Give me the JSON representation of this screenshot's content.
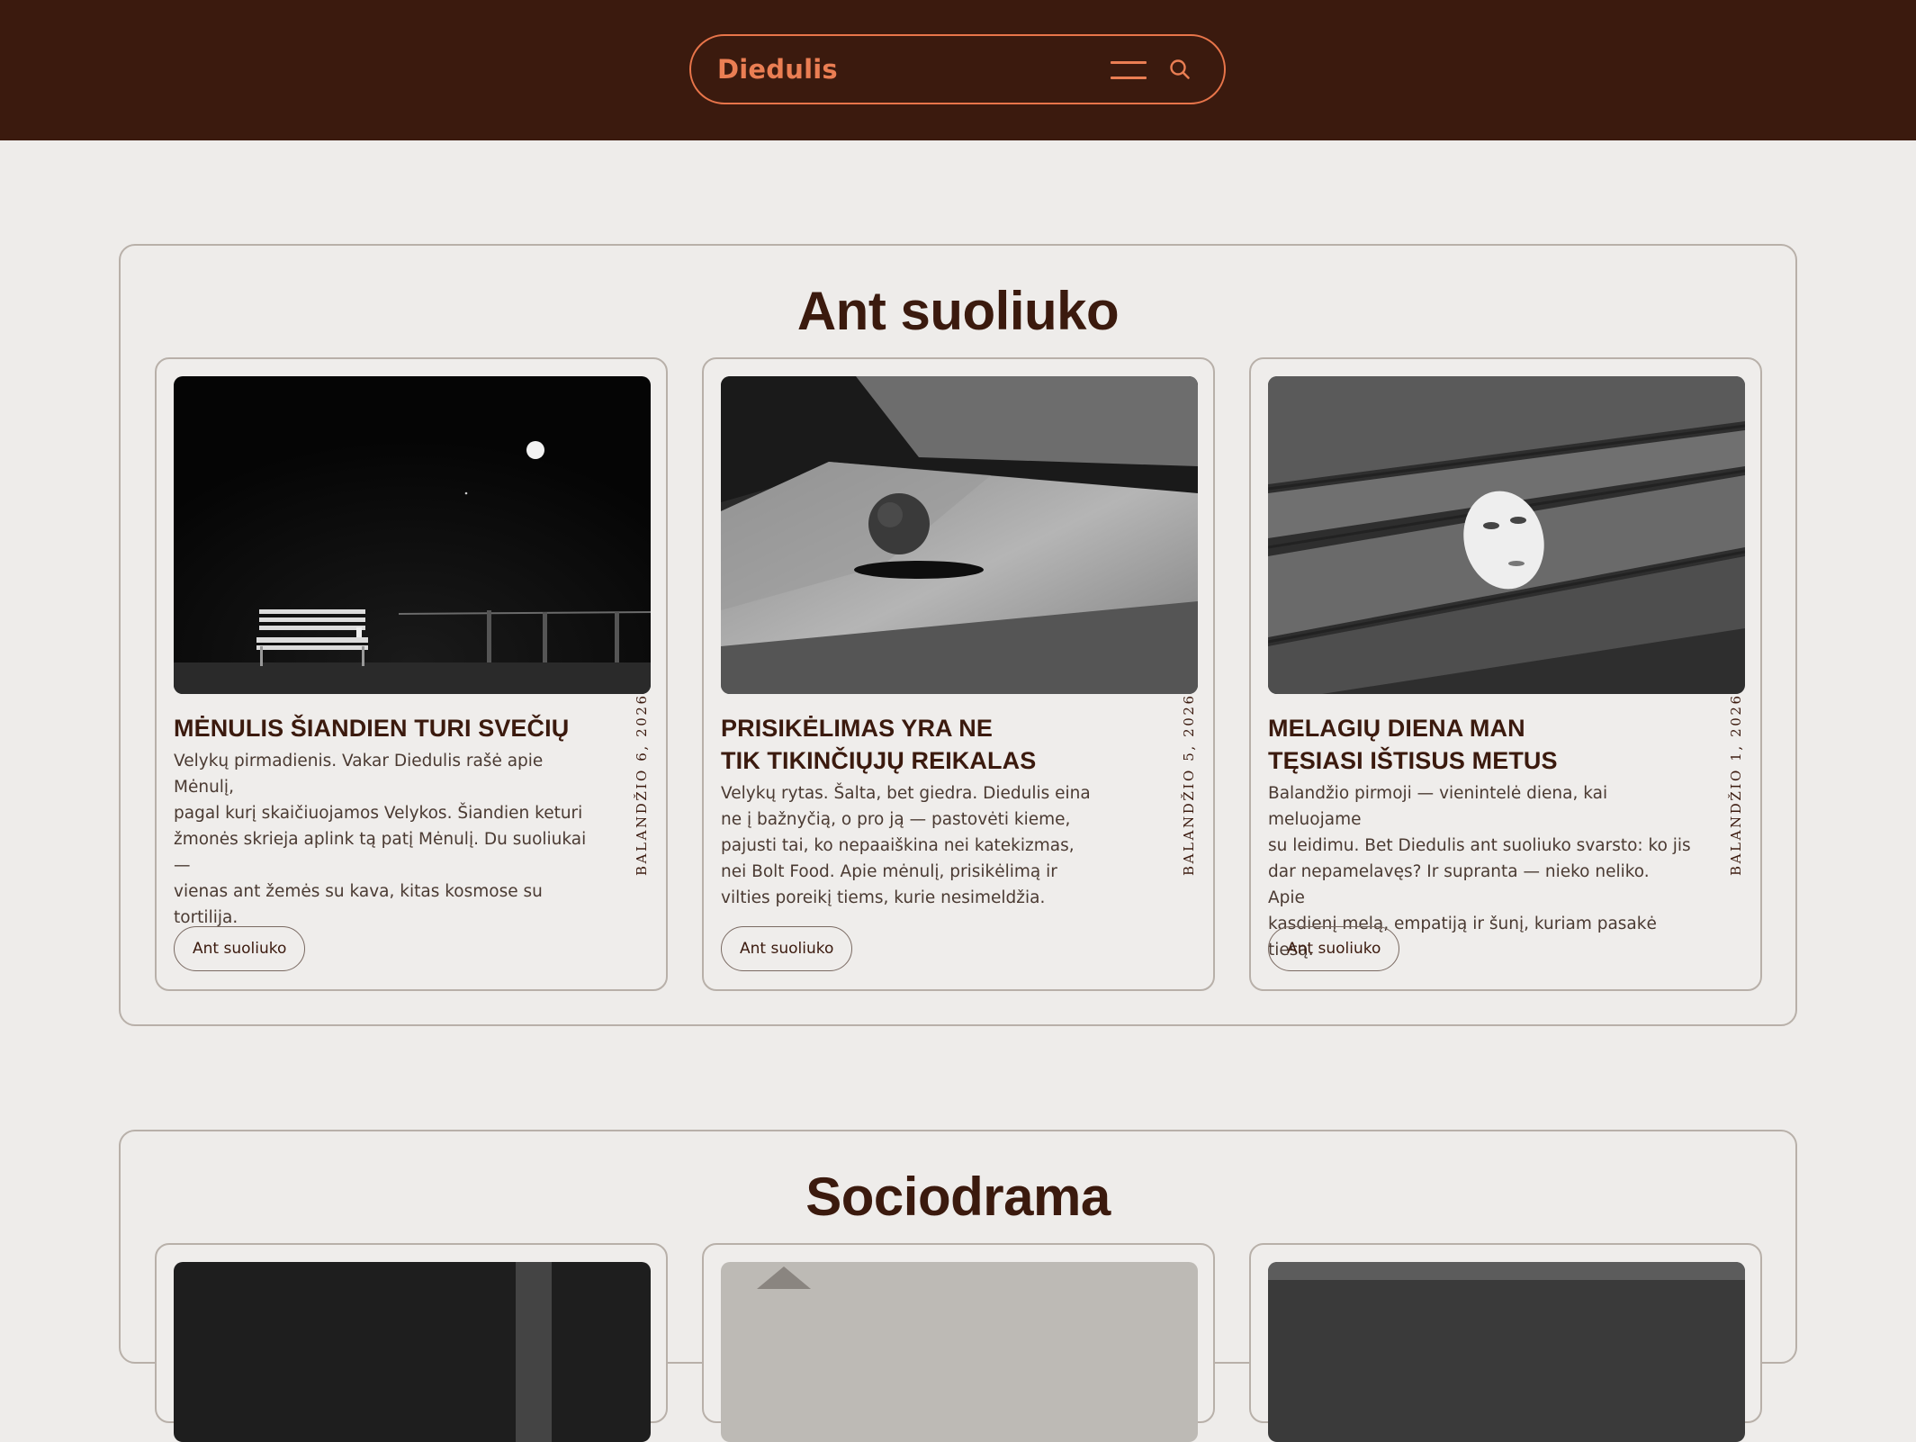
{
  "header": {
    "brand": "Diedulis",
    "menu_icon": "hamburger-menu-icon",
    "search_icon": "search-icon",
    "accent_color": "#ea7e53",
    "background_color": "#3b1a0e"
  },
  "sections": [
    {
      "title": "Ant suoliuko",
      "cards": [
        {
          "image": "Moon over a bench at night",
          "title_lines": [
            "MĖNULIS ŠIANDIEN TURI SVEČIŲ"
          ],
          "text_lines": [
            "Velykų pirmadienis. Vakar Diedulis rašė apie Mėnulį,",
            "pagal kurį skaičiuojamos Velykos. Šiandien keturi",
            "žmonės skrieja aplink tą patį Mėnulį. Du suoliukai —",
            "vienas ant žemės su kava, kitas kosmose su tortilija."
          ],
          "date": "BALANDŽIO 6, 2026",
          "tag": "Ant suoliuko"
        },
        {
          "image": "Egg on a stone slab",
          "title_lines": [
            "PRISIKĖLIMAS YRA NE",
            "TIK TIKINČIŲJŲ REIKALAS"
          ],
          "text_lines": [
            "Velykų rytas. Šalta, bet giedra. Diedulis eina",
            "ne į bažnyčią, o pro ją — pastovėti kieme,",
            "pajusti tai, ko nepaaiškina nei katekizmas,",
            "nei Bolt Food. Apie mėnulį, prisikėlimą ir",
            "vilties poreikį tiems, kurie nesimeldžia."
          ],
          "date": "BALANDŽIO 5, 2026",
          "tag": "Ant suoliuko"
        },
        {
          "image": "White mask on a wooden bench",
          "title_lines": [
            "MELAGIŲ DIENA MAN",
            "TĘSIASI IŠTISUS METUS"
          ],
          "text_lines": [
            "Balandžio pirmoji — vienintelė diena, kai meluojame",
            "su leidimu. Bet Diedulis ant suoliuko svarsto: ko jis",
            "dar nepamelavęs? Ir supranta — nieko neliko. Apie",
            "kasdienį melą, empatiją ir šunį, kuriam pasakė tiesą."
          ],
          "date": "BALANDŽIO 1, 2026",
          "tag": "Ant suoliuko"
        }
      ]
    },
    {
      "title": "Sociodrama",
      "cards": [
        {},
        {},
        {}
      ]
    }
  ]
}
